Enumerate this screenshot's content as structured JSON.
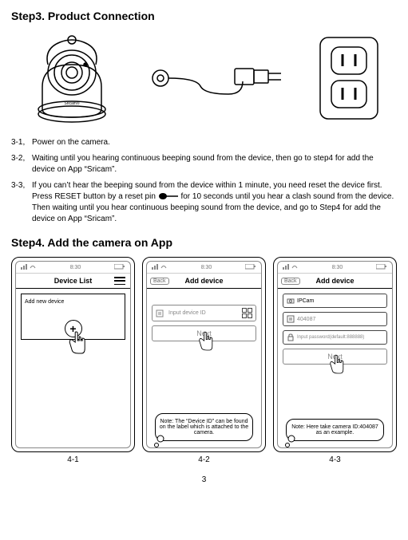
{
  "step3": {
    "title": "Step3. Product Connection",
    "items": [
      {
        "num": "3-1,",
        "text": "Power on the camera."
      },
      {
        "num": "3-2,",
        "text": "Waiting until you hearing continuous beeping sound from the device, then go to step4 for add the device on App “Sricam”."
      },
      {
        "num": "3-3,",
        "text_before": "If you can’t hear the beeping sound from the device within 1 minute, you need reset the device first. Press RESET button by a reset pin ",
        "text_after": " for 10 seconds until you hear a clash sound from the device. Then waiting until you hear continuous beeping sound from the device, and go to Step4 for add the device on App “Sricam”."
      }
    ]
  },
  "step4": {
    "title": "Step4. Add the camera on App",
    "time": "8:30",
    "phone1": {
      "title": "Device List",
      "add_label": "Add new device"
    },
    "phone2": {
      "title": "Add device",
      "back": "Back",
      "input_placeholder": "Input device ID",
      "next": "Next",
      "note": "Note: The “Device ID” can be found on the label which is attached to the camera."
    },
    "phone3": {
      "title": "Add device",
      "back": "Back",
      "name_value": "IPCam",
      "id_value": "404087",
      "pwd_placeholder": "Input password(default:888888)",
      "next": "Next",
      "note": "Note: Here take camera ID:404087 as an example."
    },
    "captions": [
      "4-1",
      "4-2",
      "4-3"
    ]
  },
  "page_number": "3"
}
